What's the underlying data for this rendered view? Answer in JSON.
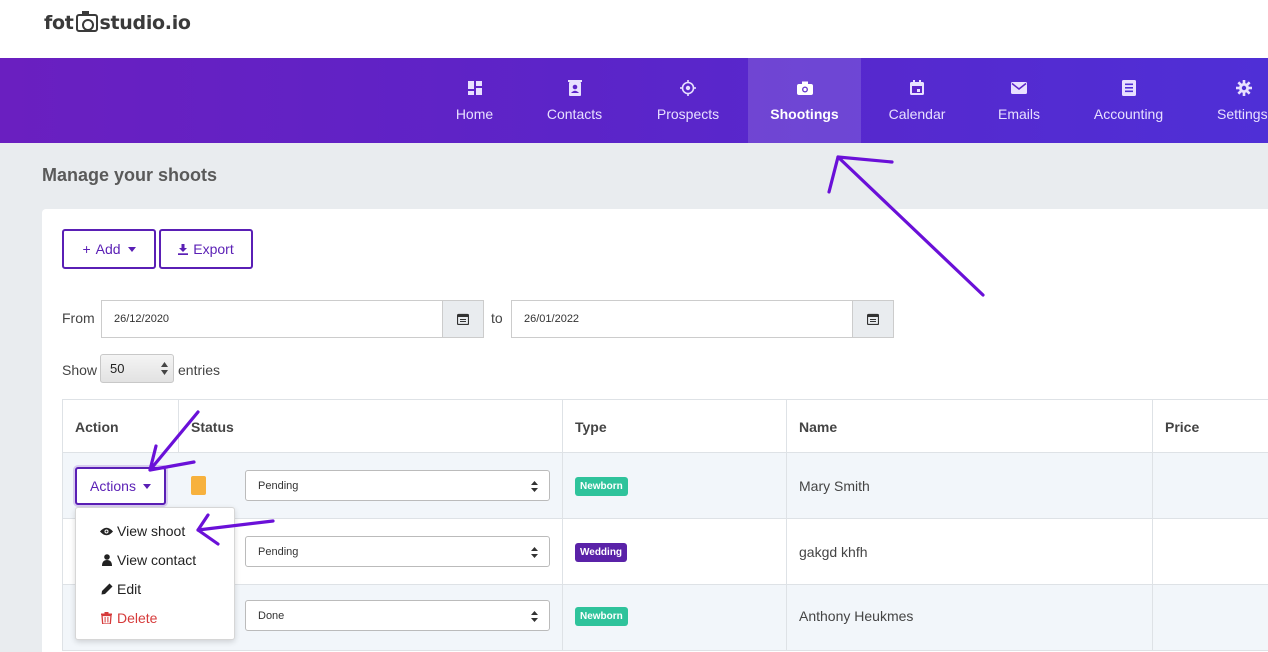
{
  "brand": {
    "logo_part1": "fot",
    "logo_part2": "studio.io"
  },
  "nav": {
    "items": [
      {
        "label": "Home",
        "icon": "dashboard-icon"
      },
      {
        "label": "Contacts",
        "icon": "contacts-icon"
      },
      {
        "label": "Prospects",
        "icon": "target-icon"
      },
      {
        "label": "Shootings",
        "icon": "camera-icon",
        "active": true
      },
      {
        "label": "Calendar",
        "icon": "calendar-icon"
      },
      {
        "label": "Emails",
        "icon": "envelope-icon"
      },
      {
        "label": "Accounting",
        "icon": "ledger-icon"
      },
      {
        "label": "Settings",
        "icon": "gear-icon"
      }
    ]
  },
  "page": {
    "title": "Manage your shoots"
  },
  "toolbar": {
    "add_label": "Add",
    "add_prefix": "+",
    "export_label": "Export"
  },
  "filters": {
    "from_label": "From",
    "from_value": "26/12/2020",
    "to_label": "to",
    "to_value": "26/01/2022",
    "show_label": "Show",
    "entries_value": "50",
    "entries_label": "entries"
  },
  "table": {
    "columns": [
      "Action",
      "Status",
      "Type",
      "Name",
      "Price"
    ],
    "rows": [
      {
        "status": "Pending",
        "type": "Newborn",
        "name": "Mary Smith",
        "price": ""
      },
      {
        "status": "Pending",
        "type": "Wedding",
        "name": "gakgd khfh",
        "price": ""
      },
      {
        "status": "Done",
        "type": "Newborn",
        "name": "Anthony Heukmes",
        "price": ""
      }
    ],
    "actions_label": "Actions"
  },
  "actions_menu": {
    "items": [
      {
        "label": "View shoot",
        "icon": "eye-icon"
      },
      {
        "label": "View contact",
        "icon": "user-icon"
      },
      {
        "label": "Edit",
        "icon": "pencil-icon"
      },
      {
        "label": "Delete",
        "icon": "trash-icon"
      }
    ]
  },
  "colors": {
    "nav_start": "#6a1fc0",
    "nav_end": "#4f2fd6",
    "accent": "#5a1fb5",
    "badge_newborn": "#2fc39b",
    "badge_wedding": "#5a22a8",
    "pending_swatch": "#f7b13d",
    "delete": "#d63b3b",
    "annotation": "#6a10d8"
  }
}
